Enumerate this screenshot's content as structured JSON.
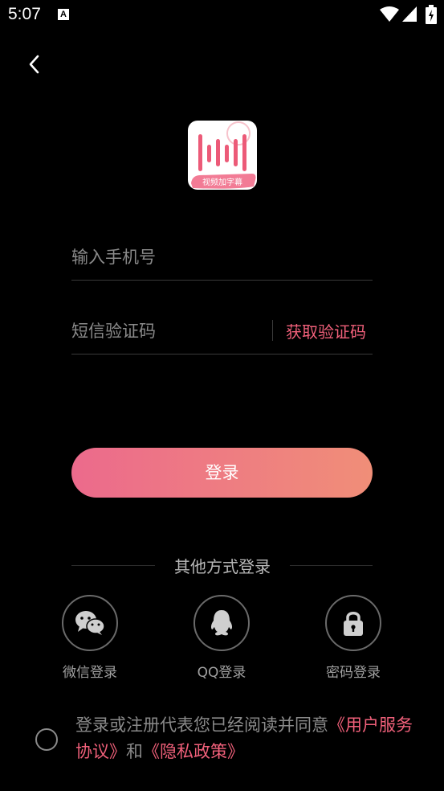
{
  "status_bar": {
    "time": "5:07",
    "notification_icon": "A"
  },
  "header": {
    "back_icon": "chevron-left-icon"
  },
  "logo": {
    "text": "视频加字幕",
    "brand_color": "#f0607a"
  },
  "form": {
    "phone_placeholder": "输入手机号",
    "code_placeholder": "短信验证码",
    "get_code_label": "获取验证码"
  },
  "login_button": {
    "label": "登录"
  },
  "other_methods": {
    "title": "其他方式登录",
    "items": [
      {
        "label": "微信登录",
        "icon": "wechat-icon"
      },
      {
        "label": "QQ登录",
        "icon": "qq-icon"
      },
      {
        "label": "密码登录",
        "icon": "lock-icon"
      }
    ]
  },
  "agreement": {
    "prefix": "登录或注册代表您已经阅读并同意",
    "user_agreement": "《用户服务协议》",
    "conjunction": "和",
    "privacy_policy": "《隐私政策》"
  },
  "colors": {
    "accent": "#f0607a",
    "button_start": "#ec6a8c",
    "button_end": "#f08e78",
    "background": "#000000"
  }
}
